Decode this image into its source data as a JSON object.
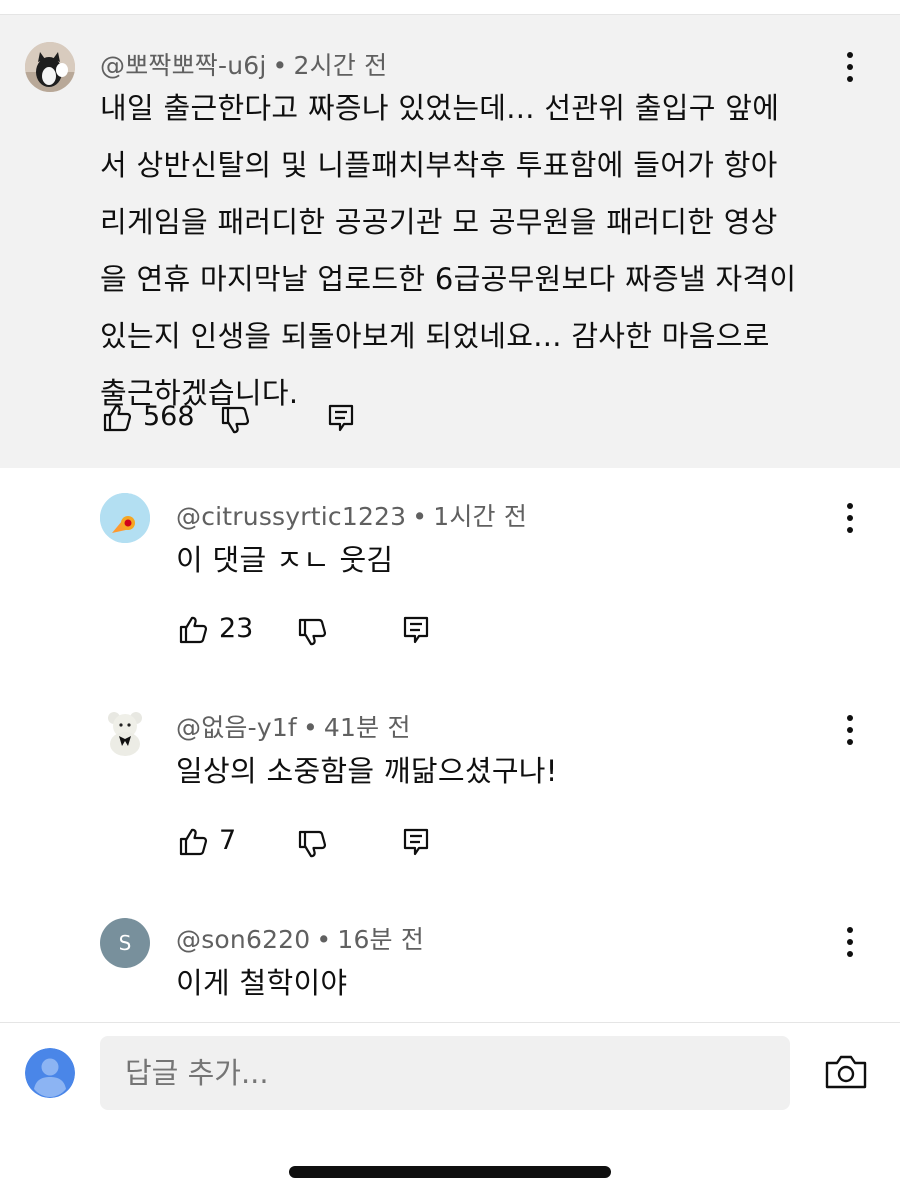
{
  "main_comment": {
    "handle": "@뽀짝뽀짝-u6j",
    "time": "2시간 전",
    "separator": "•",
    "lines": [
      "내일 출근한다고 짜증나 있었는데... 선관위 출입구 앞에",
      "서 상반신탈의 및 니플패치부착후 투표함에 들어가 항아",
      "리게임을 패러디한 공공기관 모 공무원을 패러디한 영상",
      "을 연휴 마지막날 업로드한 6급공무원보다 짜증낼 자격이",
      "있는지 인생을 되돌아보게 되었네요... 감사한 마음으로",
      "출근하겠습니다."
    ],
    "likes": "568"
  },
  "replies": [
    {
      "handle": "@citrussyrtic1223",
      "time": "1시간 전",
      "text": "이 댓글 ㅈㄴ 웃김",
      "likes": "23"
    },
    {
      "handle": "@없음-y1f",
      "time": "41분 전",
      "text": "일상의 소중함을 깨닮으셨구나!",
      "likes": "7"
    },
    {
      "handle": "@son6220",
      "time": "16분 전",
      "text": "이게 철학이야",
      "avatar_letter": "S"
    }
  ],
  "composer": {
    "placeholder": "답글 추가..."
  },
  "icons": {
    "like": "thumbs-up-icon",
    "dislike": "thumbs-down-icon",
    "reply": "reply-icon",
    "more": "more-vertical-icon",
    "camera": "camera-icon",
    "user": "user-avatar-icon"
  },
  "colors": {
    "highlight_bg": "#f2f2f2",
    "meta_text": "#606060",
    "son_avatar": "#78909c",
    "citrus_avatar": "#a8d8f0",
    "user_avatar": "#4a86e8"
  }
}
